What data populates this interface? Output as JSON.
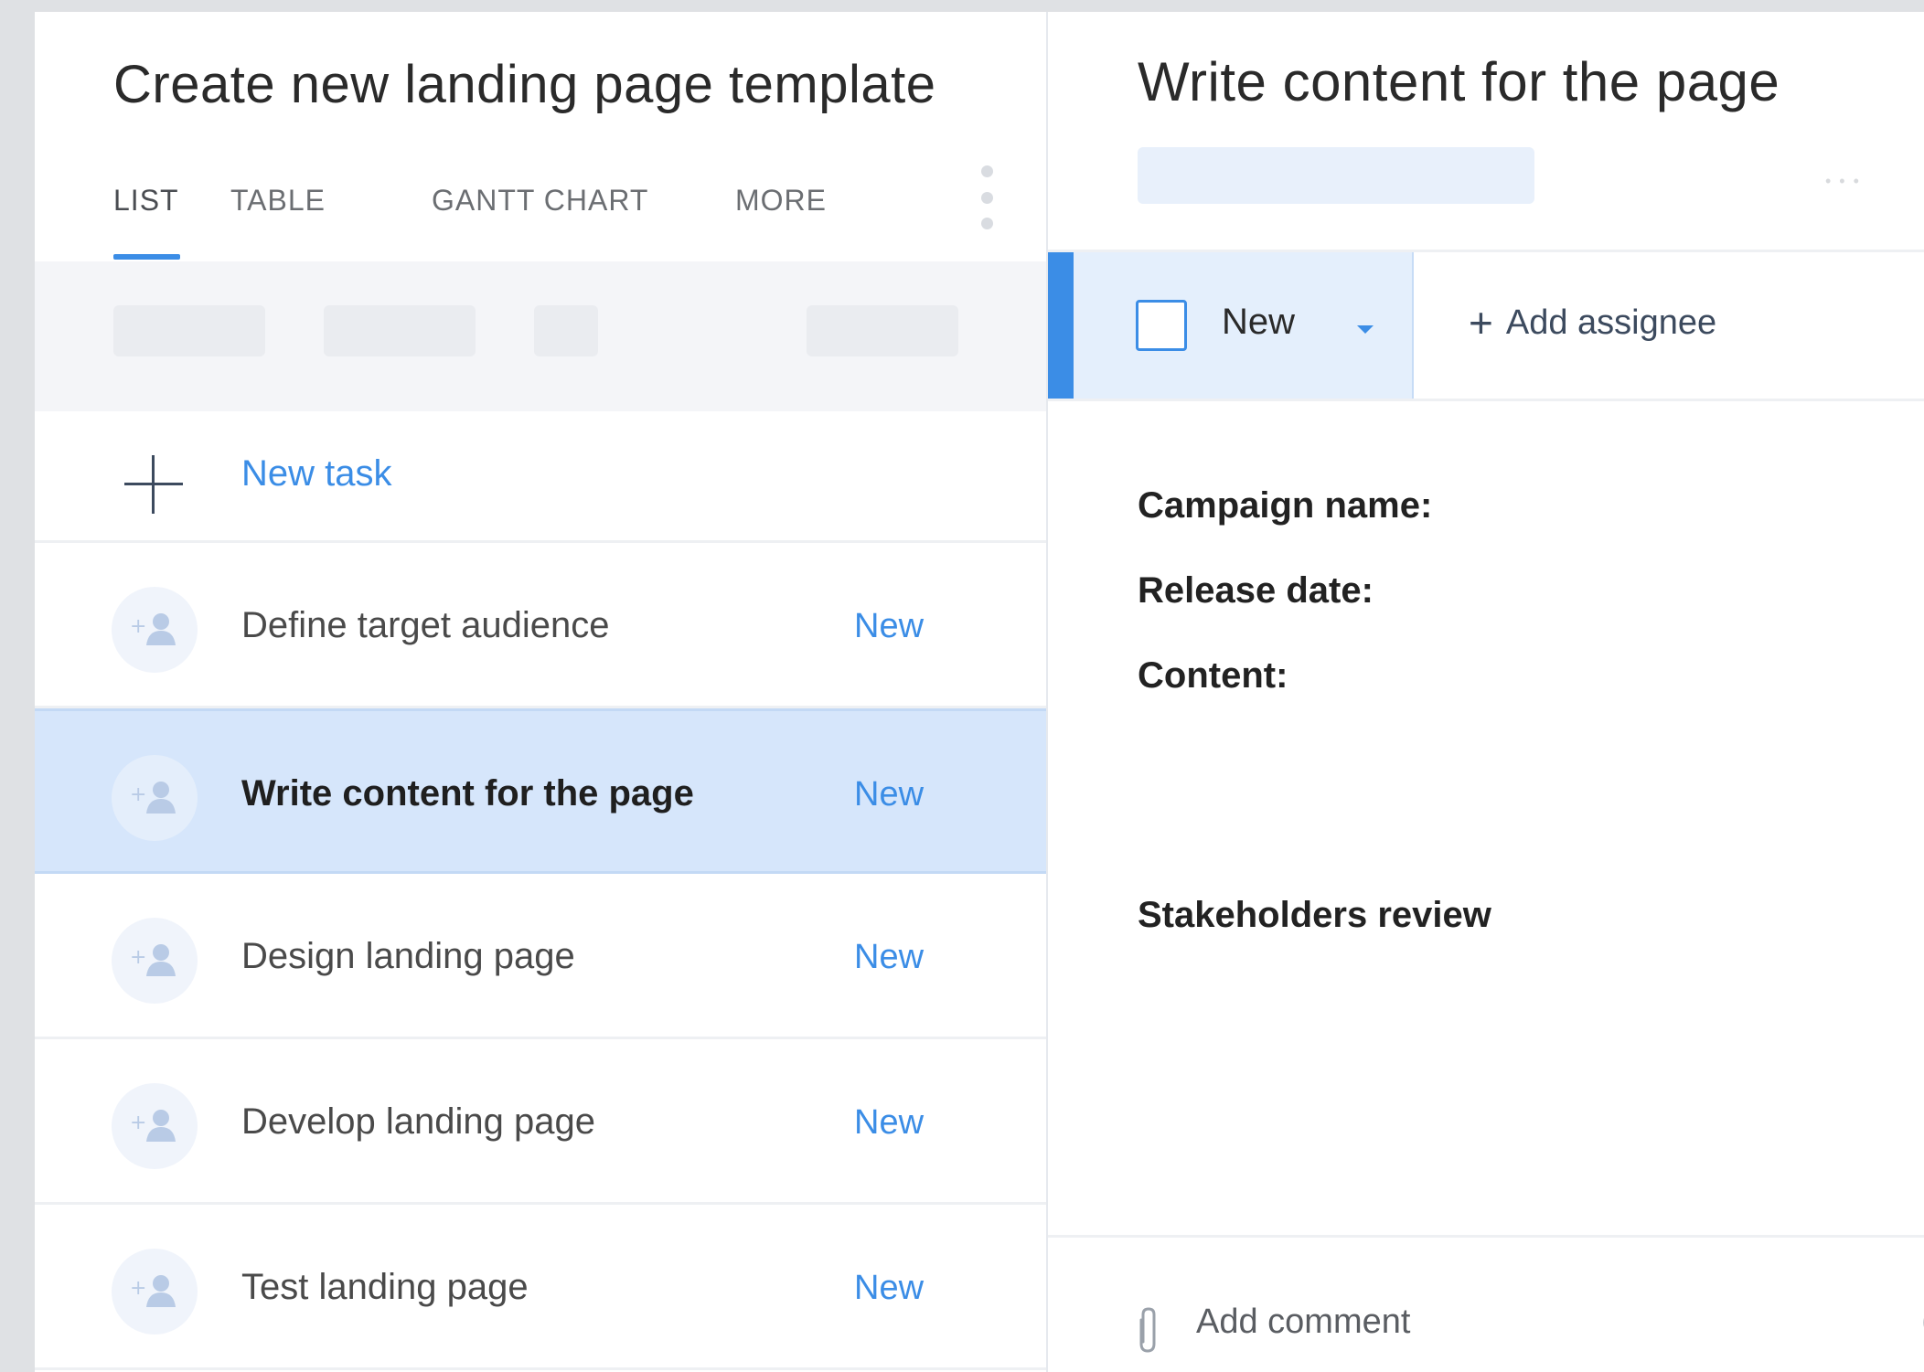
{
  "project": {
    "title": "Create new landing page template"
  },
  "tabs": [
    {
      "label": "LIST",
      "active": true
    },
    {
      "label": "TABLE",
      "active": false
    },
    {
      "label": "GANTT CHART",
      "active": false
    },
    {
      "label": "MORE",
      "active": false
    }
  ],
  "new_task": {
    "label": "New task"
  },
  "tasks": [
    {
      "name": "Define target audience",
      "status": "New",
      "selected": false
    },
    {
      "name": "Write content for the page",
      "status": "New",
      "selected": true
    },
    {
      "name": "Design landing page",
      "status": "New",
      "selected": false
    },
    {
      "name": "Develop landing page",
      "status": "New",
      "selected": false
    },
    {
      "name": "Test landing page",
      "status": "New",
      "selected": false
    }
  ],
  "detail": {
    "title": "Write content for the page",
    "status_label": "New",
    "add_assignee_label": "Add assignee",
    "description": {
      "campaign_name": "Campaign name:",
      "release_date": "Release date:",
      "content": "Content:",
      "review": "Stakeholders review"
    },
    "comment_placeholder": "Add comment"
  },
  "colors": {
    "accent": "#3b8de6",
    "selected_row": "#d6e6fb",
    "filter_bar": "#f4f5f8"
  },
  "icons": [
    "plus-icon",
    "add-user-icon",
    "chevron-down-icon",
    "paperclip-icon",
    "smile-icon",
    "more-vertical-icon",
    "more-horizontal-icon"
  ]
}
